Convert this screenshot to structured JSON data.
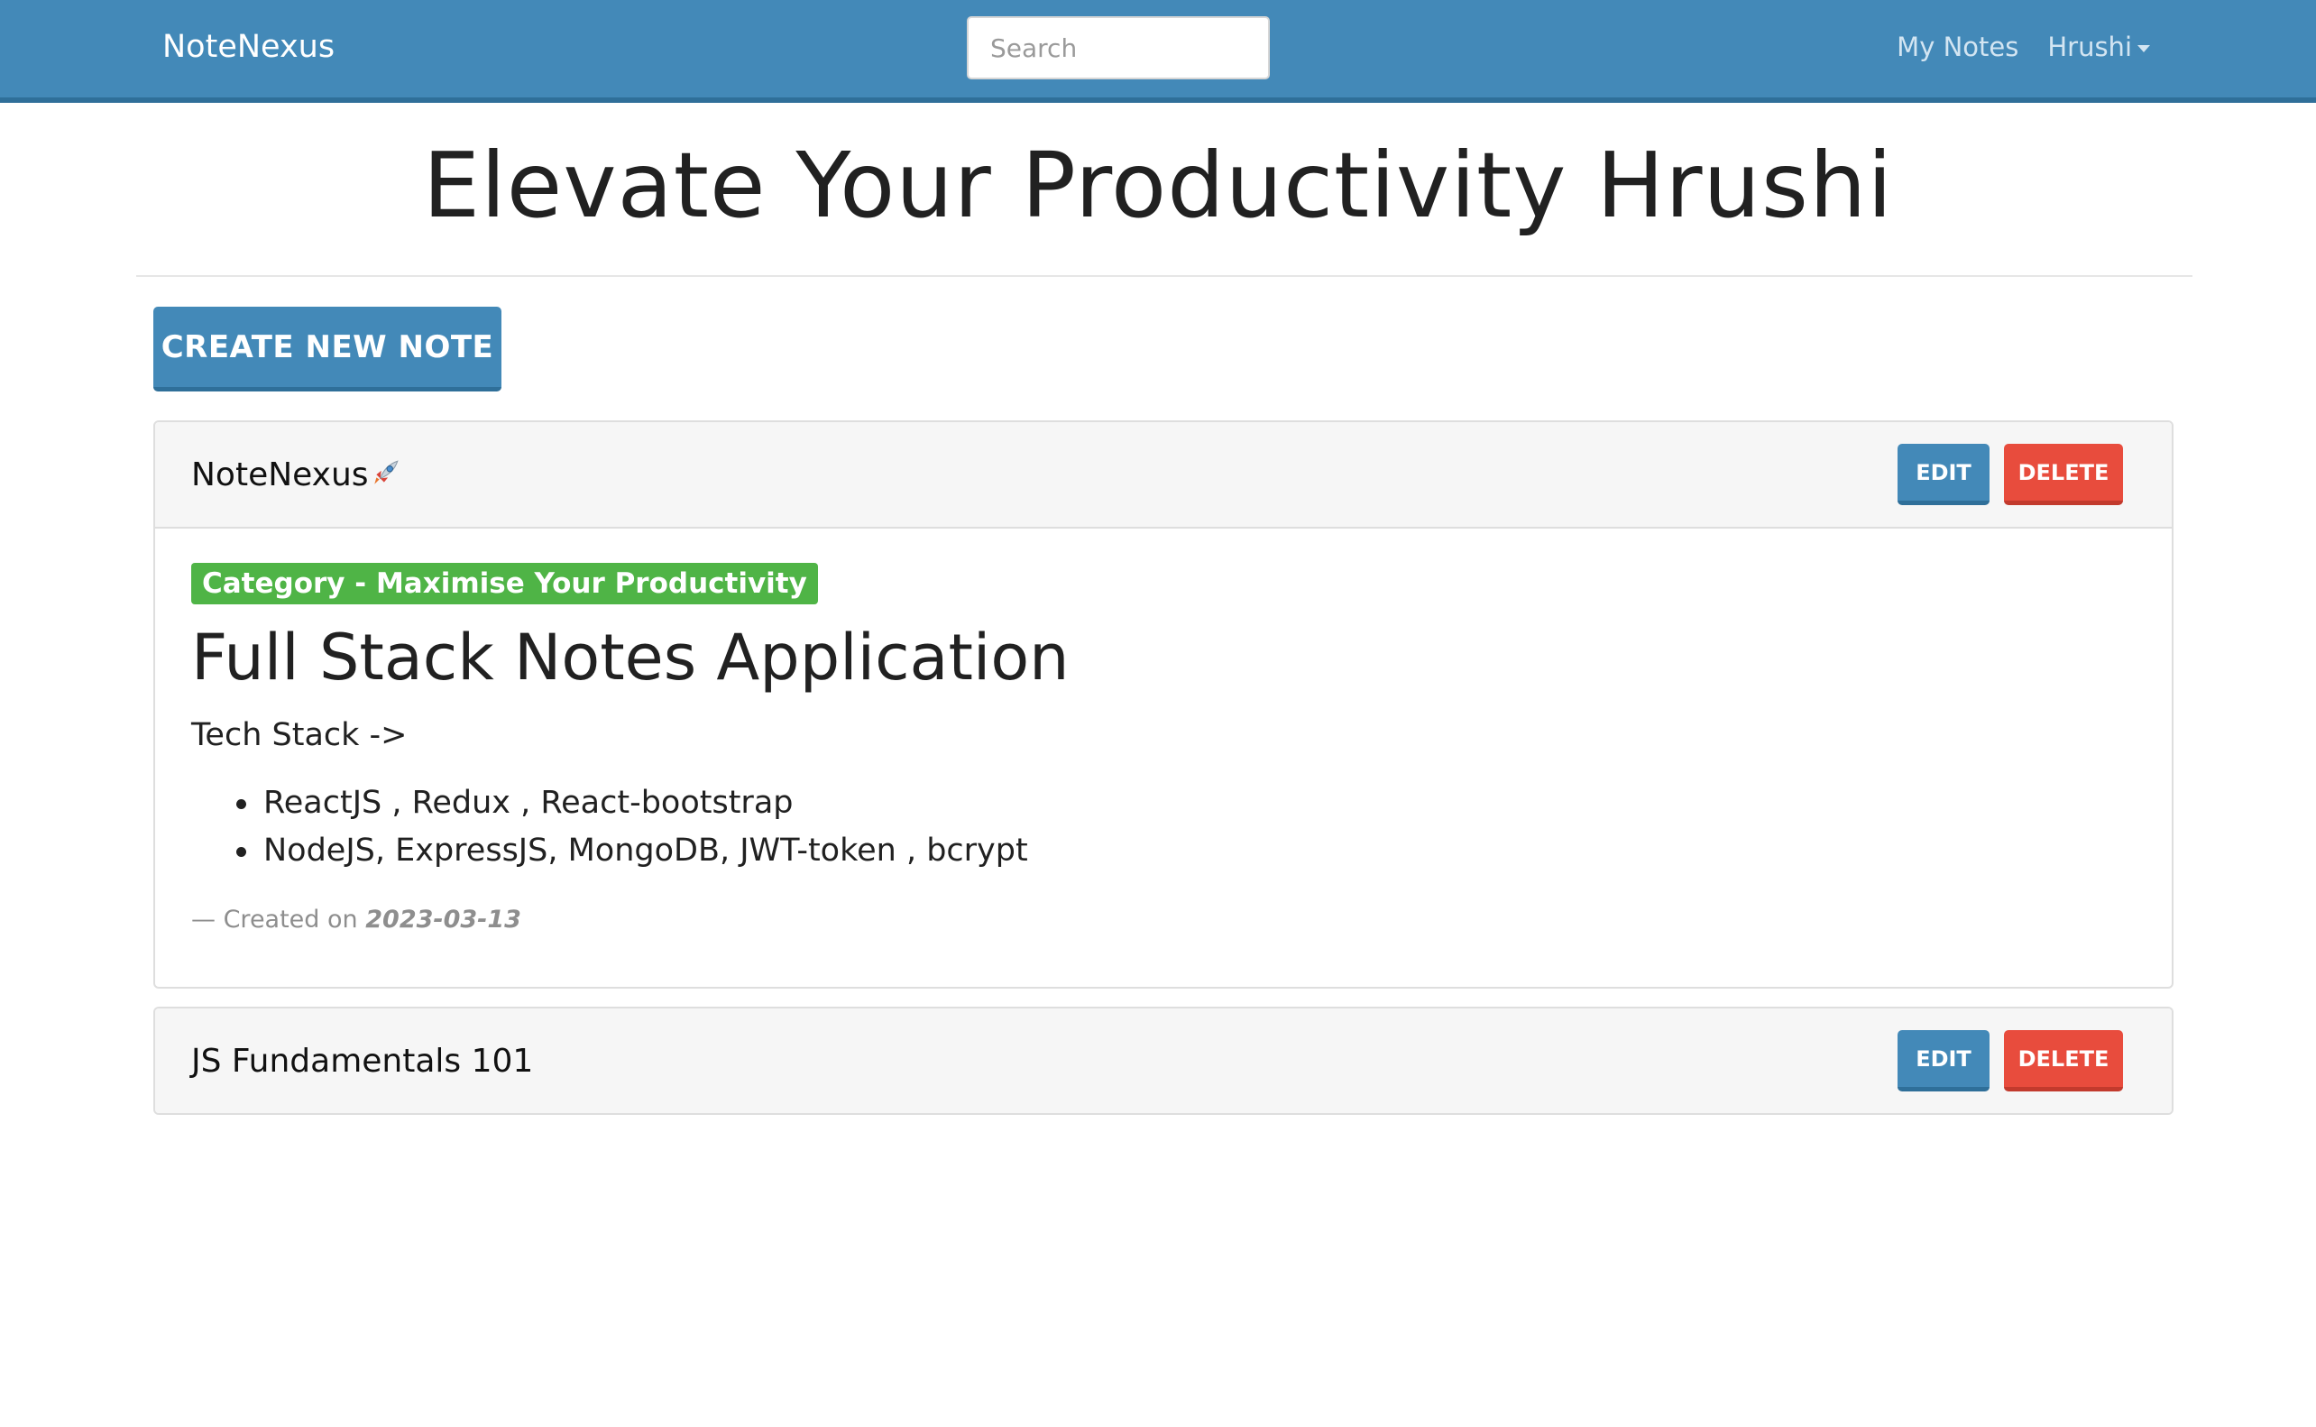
{
  "navbar": {
    "brand": "NoteNexus",
    "search_placeholder": "Search",
    "search_value": "",
    "links": {
      "my_notes": "My Notes",
      "user": "Hrushi"
    }
  },
  "page": {
    "title": "Elevate Your Productivity Hrushi",
    "create_button": "CREATE NEW NOTE"
  },
  "notes": [
    {
      "title": "NoteNexus",
      "title_icon": "rocket-icon",
      "expanded": true,
      "edit_label": "EDIT",
      "delete_label": "DELETE",
      "category": "Category - Maximise Your Productivity",
      "heading": "Full Stack Notes Application",
      "paragraph": "Tech Stack ->",
      "list": [
        "ReactJS , Redux , React-bootstrap",
        "NodeJS, ExpressJS, MongoDB, JWT-token , bcrypt"
      ],
      "created_prefix": "— Created on",
      "created_date": "2023-03-13"
    },
    {
      "title": "JS Fundamentals 101",
      "expanded": false,
      "edit_label": "EDIT",
      "delete_label": "DELETE"
    }
  ],
  "colors": {
    "primary": "#4389b8",
    "danger": "#e84c3d",
    "success": "#4fb446",
    "muted": "#8e8e8e"
  }
}
